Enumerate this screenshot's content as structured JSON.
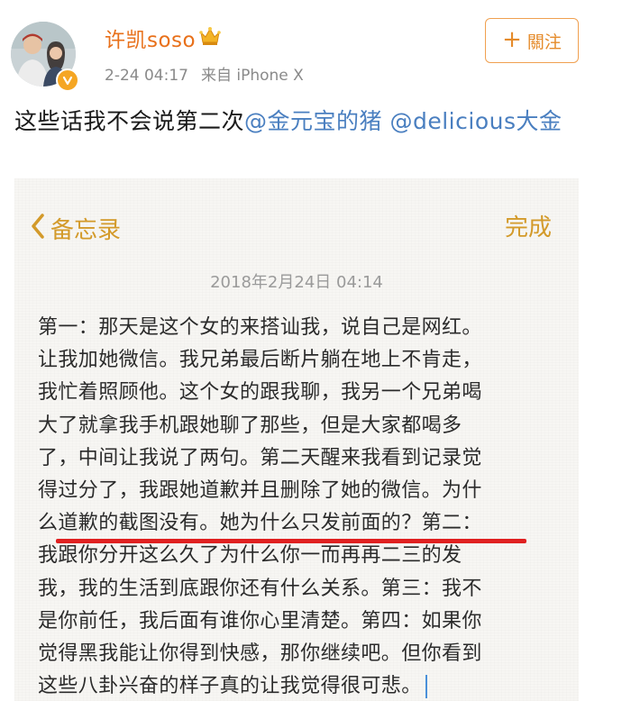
{
  "header": {
    "username": "许凯soso",
    "timestamp": "2-24 04:17",
    "source": "来自 iPhone X",
    "follow_label": "關注",
    "follow_plus": "+"
  },
  "icons": {
    "avatar": "avatar-photo",
    "verified": "verified-badge-icon",
    "crown": "crown-vip-icon",
    "back": "chevron-left-icon"
  },
  "colors": {
    "username": "#e8701a",
    "mention": "#4a7fc0",
    "notes_accent": "#d39a2a",
    "underline": "#e02020"
  },
  "post": {
    "text": "这些话我不会说第二次",
    "mentions": [
      "@金元宝的猪",
      "@delicious大金"
    ]
  },
  "notes": {
    "back_label": "备忘录",
    "done_label": "完成",
    "date": "2018年2月24日 04:14",
    "lines": [
      "第一：那天是这个女的来搭讪我，说自己是网红。",
      "让我加她微信。我兄弟最后断片躺在地上不肯走，",
      "我忙着照顾他。这个女的跟我聊，我另一个兄弟喝",
      "大了就拿我手机跟她聊了那些，但是大家都喝多",
      "了，中间让我说了两句。第二天醒来我看到记录觉",
      "得过分了，我跟她道歉并且删除了她的微信。为什",
      "么道歉的截图没有。她为什么只发前面的？第二：",
      "我跟你分开这么久了为什么你一而再再二三的发",
      "我，我的生活到底跟你还有什么关系。第三：我不",
      "是你前任，我后面有谁你心里清楚。第四：如果你",
      "觉得黑我能让你得到快感，那你继续吧。但你看到",
      "这些八卦兴奋的样子真的让我觉得很可悲。"
    ]
  }
}
